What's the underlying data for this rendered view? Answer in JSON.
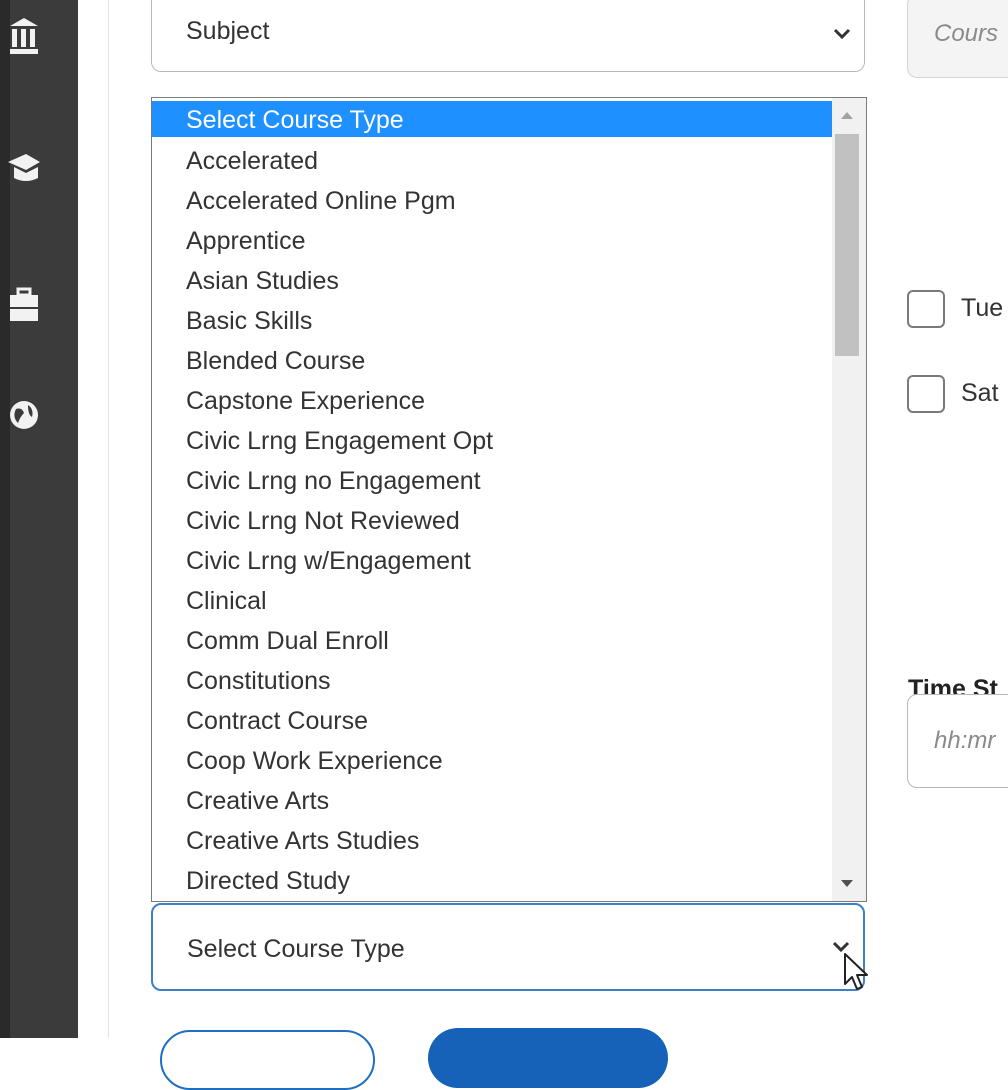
{
  "subject_select": {
    "value": "Subject"
  },
  "course_type_dropdown": {
    "options": [
      "Select Course Type",
      "Accelerated",
      "Accelerated Online Pgm",
      "Apprentice",
      "Asian Studies",
      "Basic Skills",
      "Blended Course",
      "Capstone Experience",
      "Civic Lrng Engagement Opt",
      "Civic Lrng no Engagement",
      "Civic Lrng Not Reviewed",
      "Civic Lrng w/Engagement",
      "Clinical",
      "Comm Dual Enroll",
      "Constitutions",
      "Contract Course",
      "Coop Work Experience",
      "Creative Arts",
      "Creative Arts Studies",
      "Directed Study"
    ],
    "highlighted_index": 0
  },
  "course_type_select": {
    "value": "Select Course Type"
  },
  "course_input": {
    "placeholder": "Cours"
  },
  "day_checkboxes": [
    {
      "label": "Tue"
    },
    {
      "label": "Sat"
    }
  ],
  "time_start": {
    "label": "Time St",
    "placeholder": "hh:mr"
  },
  "colors": {
    "accent": "#1e90ff",
    "focus_border": "#3f7fc7",
    "rail": "#3b3b3b",
    "primary_button": "#1562b8"
  },
  "icons": [
    "institution-icon",
    "graduation-cap-icon",
    "briefcase-icon",
    "globe-icon"
  ]
}
